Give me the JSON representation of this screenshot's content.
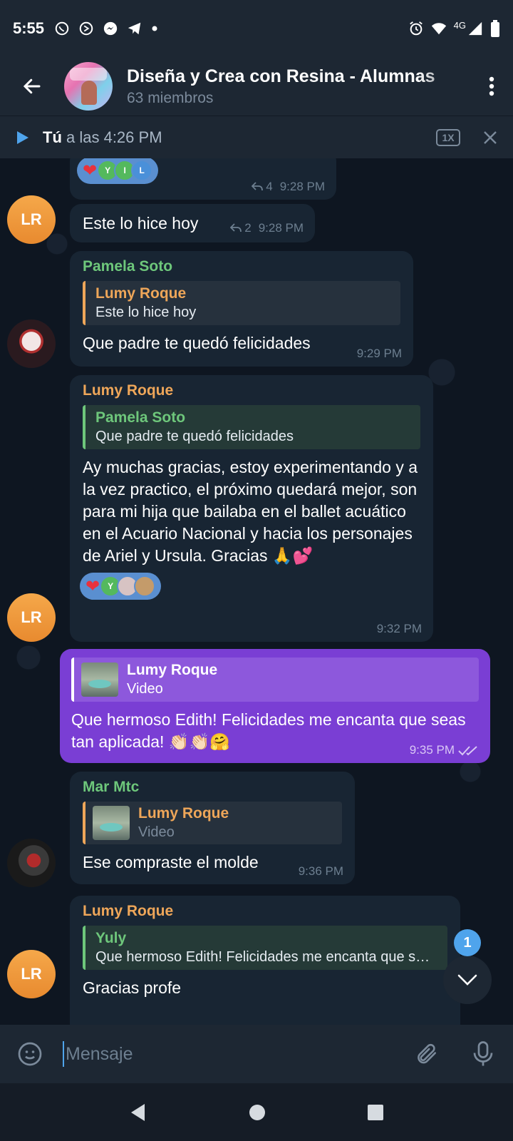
{
  "status_bar": {
    "time": "5:55",
    "network": "4G",
    "left_icons": [
      "whatsapp-icon",
      "app-icon",
      "messenger-icon",
      "telegram-icon",
      "dot-icon"
    ],
    "right_icons": [
      "alarm-icon",
      "wifi-icon",
      "signal-icon",
      "battery-icon"
    ]
  },
  "header": {
    "title": "Diseña y Crea con Resina - Alumnas",
    "subtitle": "63 miembros"
  },
  "playback": {
    "author": "Tú",
    "time_text": " a las 4:26 PM",
    "speed": "1X"
  },
  "messages": [
    {
      "id": "m0",
      "reactions": [
        "Y",
        "I",
        "L"
      ],
      "replies": "4",
      "time": "9:28 PM"
    },
    {
      "id": "m1",
      "text": "Este lo hice hoy",
      "replies": "2",
      "time": "9:28 PM"
    },
    {
      "id": "m2",
      "sender": "Pamela Soto",
      "reply_name": "Lumy Roque",
      "reply_text": "Este lo hice hoy",
      "text": "Que padre te quedó felicidades",
      "time": "9:29 PM"
    },
    {
      "id": "m3",
      "sender": "Lumy Roque",
      "reply_name": "Pamela Soto",
      "reply_text": "Que padre te quedó felicidades",
      "text": "Ay muchas gracias, estoy experimentando y a la vez practico, el próximo quedará mejor, son para mi hija que bailaba en el ballet acuático en el Acuario Nacional y hacia los personajes de Ariel y Ursula. Gracias 🙏💕",
      "reactions": [
        "Y"
      ],
      "time": "9:32 PM"
    },
    {
      "id": "m4",
      "reply_name": "Lumy Roque",
      "reply_text": "Video",
      "text": "Que hermoso Edith! Felicidades me encanta que seas tan aplicada! 👏🏻👏🏻🤗",
      "time": "9:35 PM"
    },
    {
      "id": "m5",
      "sender": "Mar Mtc",
      "reply_name": "Lumy Roque",
      "reply_text": "Video",
      "text": "Ese compraste el molde",
      "time": "9:36 PM"
    },
    {
      "id": "m6",
      "sender": "Lumy Roque",
      "reply_name": "Yuly",
      "reply_text": "Que hermoso Edith! Felicidades me encanta que seas tan aplicada!",
      "text": "Gracias profe"
    }
  ],
  "avatar_initials": "LR",
  "unread_count": "1",
  "input": {
    "placeholder": "Mensaje"
  },
  "colors": {
    "accent": "#4fa4ec",
    "outgoing": "#7a3ed4",
    "green_name": "#6ec77b",
    "orange_name": "#eea659"
  }
}
